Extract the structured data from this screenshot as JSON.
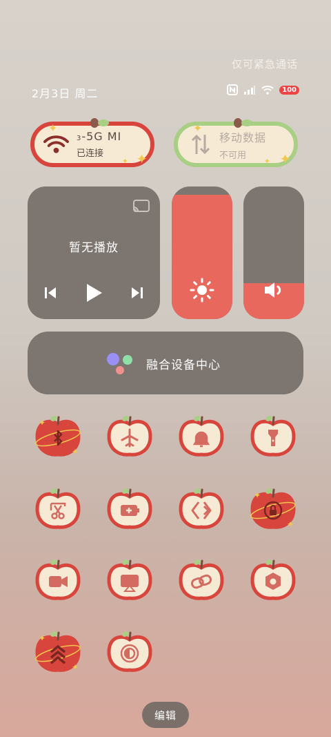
{
  "status_bar": {
    "emergency_text": "仅可紧急通话",
    "date_text": "2月3日 周二",
    "battery": "100"
  },
  "wifi_tile": {
    "ssid": "-5G    MI",
    "ssid_prefix": "3",
    "status": "已连接"
  },
  "mobile_data_tile": {
    "label": "移动数据",
    "status": "不可用"
  },
  "media": {
    "title": "暂无播放"
  },
  "brightness": {
    "level": 0.94
  },
  "volume": {
    "level": 0.27
  },
  "fusion": {
    "label": "融合设备中心"
  },
  "toggles": [
    {
      "name": "bluetooth",
      "active": true
    },
    {
      "name": "airplane",
      "active": false
    },
    {
      "name": "sound",
      "active": false
    },
    {
      "name": "flashlight",
      "active": false
    },
    {
      "name": "screenshot",
      "active": false
    },
    {
      "name": "battery-saver",
      "active": false
    },
    {
      "name": "nearby",
      "active": false
    },
    {
      "name": "rotation-lock",
      "active": true
    },
    {
      "name": "screen-record",
      "active": false
    },
    {
      "name": "cast",
      "active": false
    },
    {
      "name": "link",
      "active": false
    },
    {
      "name": "settings",
      "active": false
    },
    {
      "name": "performance",
      "active": true
    },
    {
      "name": "eye-comfort",
      "active": false
    }
  ],
  "edit_label": "编辑",
  "colors": {
    "apple_red": "#d8453c",
    "cream": "#f7ead5",
    "leaf_green": "#a8cf84",
    "card_gray": "#7d7570",
    "slider_fill": "#e9685d"
  }
}
